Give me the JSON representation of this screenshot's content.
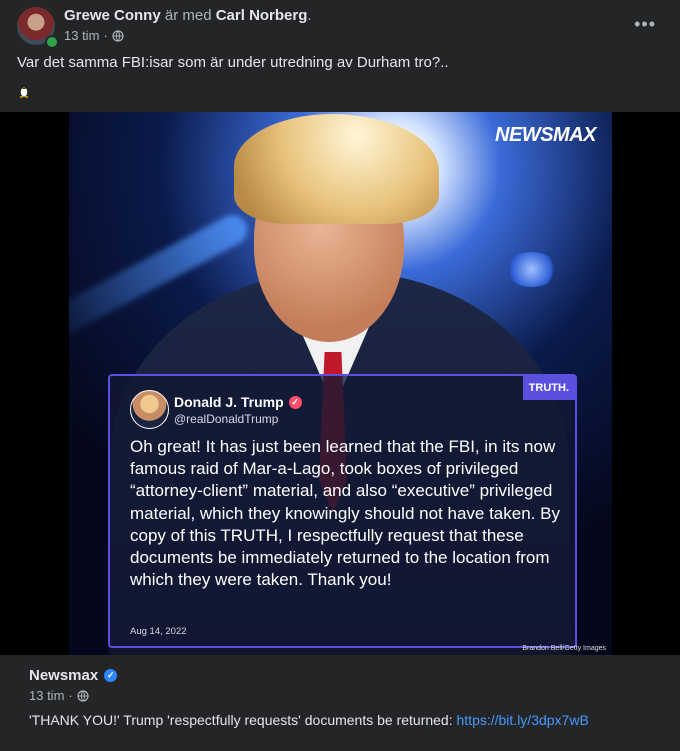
{
  "post": {
    "author": "Grewe Conny",
    "with_text": "är med",
    "tagged": "Carl Norberg",
    "time": "13 tim",
    "dot": "·",
    "period": ".",
    "text": "Var det samma FBI:isar som är under utredning av Durham tro?..",
    "more": "•••"
  },
  "image": {
    "brand": "NEWSMAX",
    "credit": "Brandon Bell/Getty Images",
    "card": {
      "platform": "TRUTH.",
      "name": "Donald J. Trump",
      "handle": "@realDonaldTrump",
      "text": "Oh great! It has just been learned that the FBI, in its now famous raid of Mar-a-Lago, took boxes of privileged “attorney-client” material, and also “executive” privileged material, which they knowingly should not have taken. By copy of this TRUTH, I respectfully request that these documents be immediately returned to the location from which they were taken. Thank you!",
      "date": "Aug 14, 2022"
    }
  },
  "shared": {
    "source": "Newsmax",
    "time": "13 tim",
    "dot": "·",
    "description": "'THANK YOU!' Trump 'respectfully requests' documents be returned:",
    "url": "https://bit.ly/3dpx7wB"
  }
}
